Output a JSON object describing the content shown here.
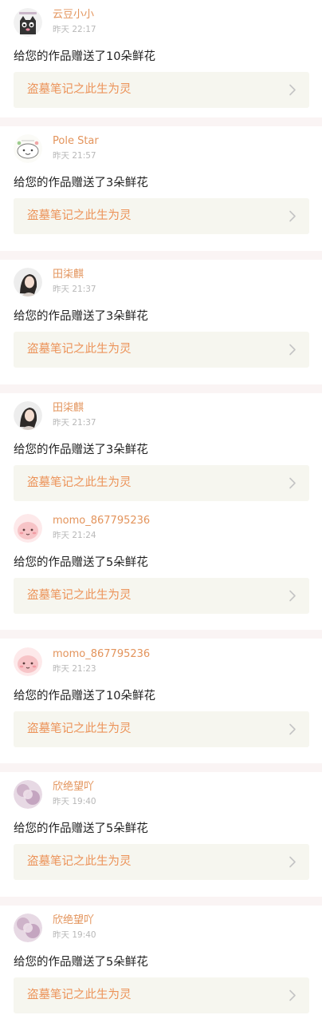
{
  "notifications": [
    {
      "user": "云豆小小",
      "time": "昨天 22:17",
      "message": "给您的作品赠送了10朵鲜花",
      "work_title": "盗墓笔记之此生为灵",
      "avatar_icon": "cat-avatar-icon"
    },
    {
      "user": "Pole Star",
      "time": "昨天 21:57",
      "message": "给您的作品赠送了3朵鲜花",
      "work_title": "盗墓笔记之此生为灵",
      "avatar_icon": "doodle-avatar-icon"
    },
    {
      "user": "田柒麒",
      "time": "昨天 21:37",
      "message": "给您的作品赠送了3朵鲜花",
      "work_title": "盗墓笔记之此生为灵",
      "avatar_icon": "portrait-avatar-icon"
    },
    {
      "user": "田柒麒",
      "time": "昨天 21:37",
      "message": "给您的作品赠送了3朵鲜花",
      "work_title": "盗墓笔记之此生为灵",
      "avatar_icon": "portrait-avatar-icon"
    },
    {
      "user": "momo_867795236",
      "time": "昨天 21:24",
      "message": "给您的作品赠送了5朵鲜花",
      "work_title": "盗墓笔记之此生为灵",
      "avatar_icon": "pink-character-avatar-icon"
    },
    {
      "user": "momo_867795236",
      "time": "昨天 21:23",
      "message": "给您的作品赠送了10朵鲜花",
      "work_title": "盗墓笔记之此生为灵",
      "avatar_icon": "pink-character-avatar-icon"
    },
    {
      "user": "欣绝望吖",
      "time": "昨天 19:40",
      "message": "给您的作品赠送了5朵鲜花",
      "work_title": "盗墓笔记之此生为灵",
      "avatar_icon": "blurred-avatar-icon"
    },
    {
      "user": "欣绝望吖",
      "time": "昨天 19:40",
      "message": "给您的作品赠送了5朵鲜花",
      "work_title": "盗墓笔记之此生为灵",
      "avatar_icon": "blurred-avatar-icon"
    }
  ],
  "colors": {
    "username": "#e3945c",
    "work_title": "#ec9359",
    "work_card_bg": "#f6f6ef",
    "separator": "#faf4f4",
    "timestamp": "#b8b8b8"
  }
}
